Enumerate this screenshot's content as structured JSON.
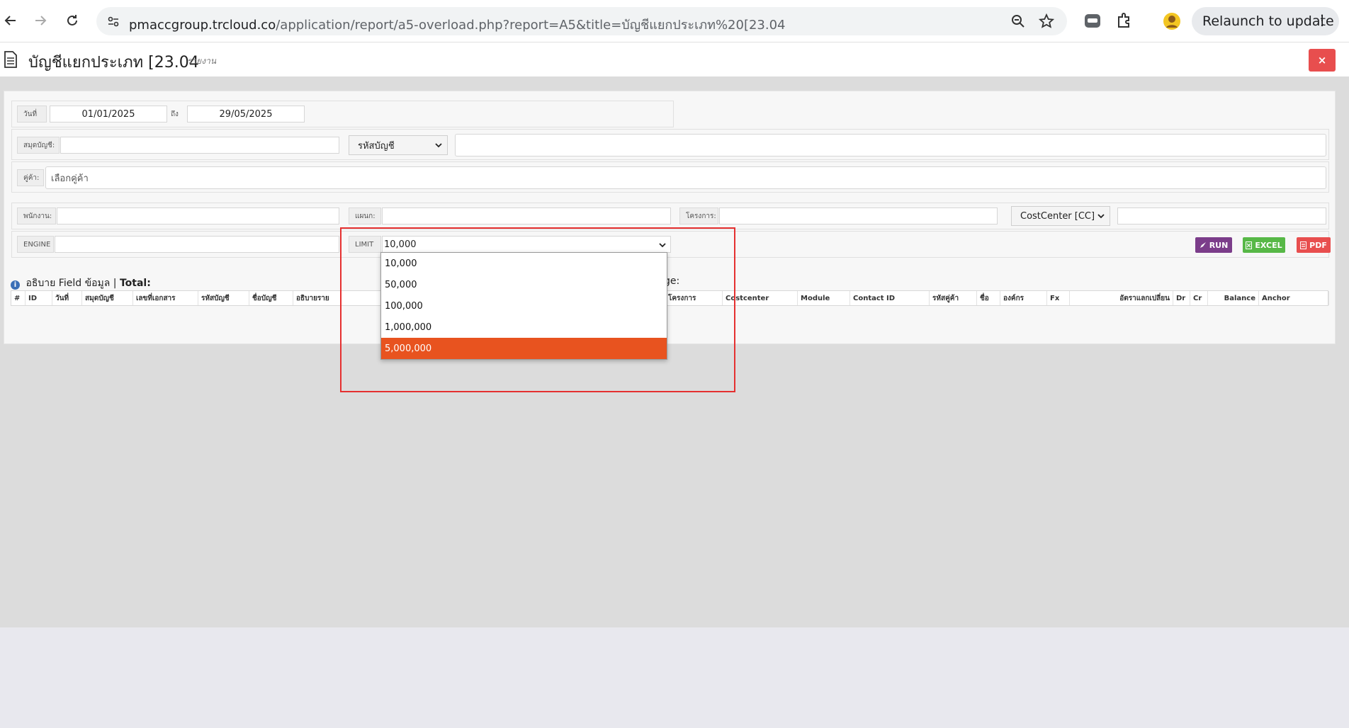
{
  "browser": {
    "url_host": "pmaccgroup.trcloud.co",
    "url_path": "/application/report/a5-overload.php?report=A5&title=บัญชีแยกประเภท%20[23.04",
    "relaunch_label": "Relaunch to update"
  },
  "header": {
    "title": "บัญชีแยกประเภท [23.04",
    "subtitle": "รายงาน",
    "close_label": "×"
  },
  "filters": {
    "date_label": "วันที่",
    "date_from": "01/01/2025",
    "to_label": "ถึง",
    "date_to": "29/05/2025",
    "journal_label": "สมุดบัญชี:",
    "journal_value": "",
    "account_select": "รหัสบัญชี",
    "account_value": "",
    "contact_label": "คู่ค้า:",
    "contact_placeholder": "เลือกคู่ค้า",
    "employee_label": "พนักงาน:",
    "employee_value": "",
    "department_label": "แผนก:",
    "department_value": "",
    "project_label": "โครงการ:",
    "project_value": "",
    "costcenter_select": "CostCenter [CC]",
    "costcenter_value": "",
    "engine_label": "ENGINE",
    "engine_value": "",
    "limit_label": "LIMIT",
    "limit_value": "10,000"
  },
  "limit_options": [
    "10,000",
    "50,000",
    "100,000",
    "1,000,000",
    "5,000,000"
  ],
  "limit_highlighted": "5,000,000",
  "actions": {
    "run": "RUN",
    "excel": "EXCEL",
    "pdf": "PDF"
  },
  "info": {
    "text": "อธิบาย Field ข้อมูล",
    "separator": " | ",
    "total_label": "Total:",
    "page_suffix": "ge:"
  },
  "table": {
    "columns": [
      "#",
      "ID",
      "วันที่",
      "สมุดบัญชี",
      "เลขที่เอกสาร",
      "รหัสบัญชี",
      "ชื่อบัญชี",
      "อธิบายราย",
      "",
      "โครงการ",
      "Costcenter",
      "Module",
      "Contact ID",
      "รหัสคู่ค้า",
      "ชื่อ",
      "องค์กร",
      "Fx",
      "อัตราแลกเปลี่ยน",
      "Dr",
      "Cr",
      "Balance",
      "Anchor"
    ]
  },
  "colors": {
    "selected_option": "#e8531f",
    "run_button": "#7b3d8a",
    "excel_button": "#57b847",
    "pdf_button": "#e84e4e",
    "highlight_box": "#e53030"
  }
}
